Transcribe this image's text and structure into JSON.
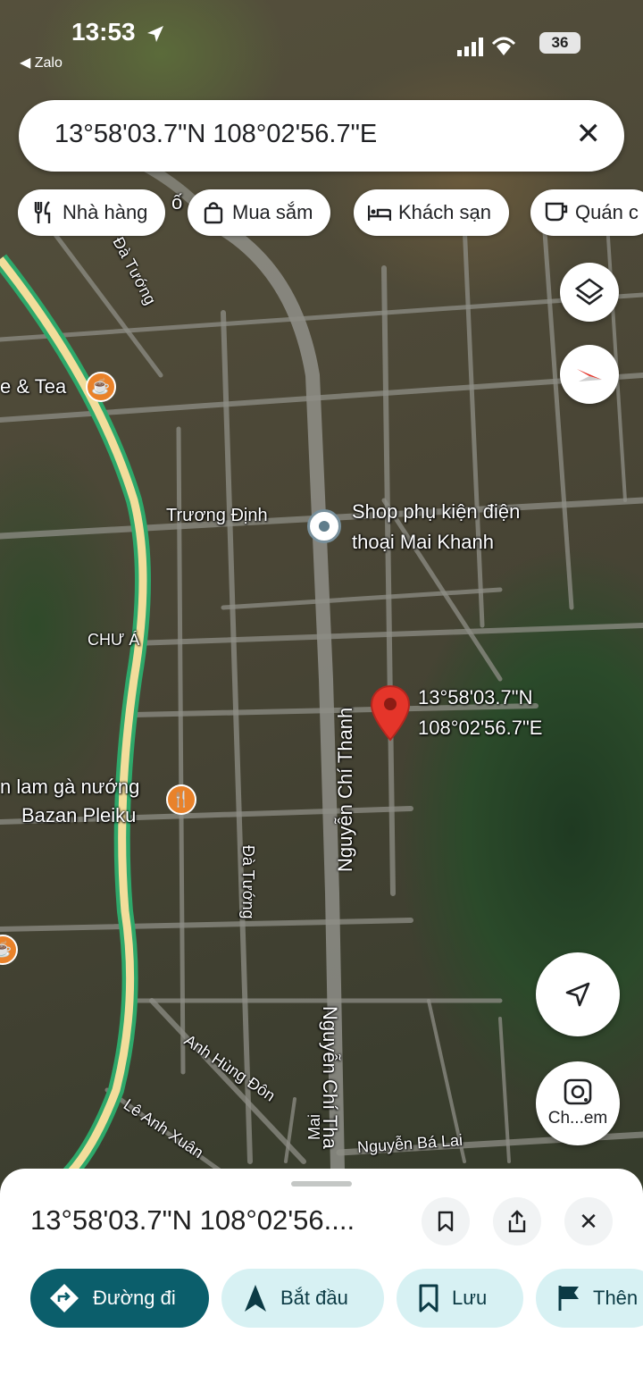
{
  "status_bar": {
    "time": "13:53",
    "back_app": "Zalo",
    "battery": "36"
  },
  "search": {
    "query": "13°58'03.7\"N 108°02'56.7\"E",
    "close_icon": "close-icon"
  },
  "chips": [
    {
      "label": "Nhà hàng",
      "icon": "fork-knife-icon"
    },
    {
      "label": "Mua sắm",
      "icon": "shopping-bag-icon"
    },
    {
      "label": "Khách sạn",
      "icon": "bed-icon"
    },
    {
      "label": "Quán c",
      "icon": "coffee-icon"
    }
  ],
  "map_labels": {
    "cafe_tea": "e & Tea",
    "truong_dinh": "Trương Định",
    "shop_line1": "Shop phụ kiện điện",
    "shop_line2": "thoại Mai Khanh",
    "chu_a": "CHƯ Á",
    "restaurant_line1": "n lam gà nướng",
    "restaurant_line2": "Bazan Pleiku",
    "da_tuong_top": "Đà Tướng",
    "da_tuong_mid": "Đà Tướng",
    "nguyen_chi_thanh_1": "Nguyễn Chí Thanh",
    "nguyen_chi_thanh_2": "Nguyễn Chí Tha",
    "anh_hung_don": "Anh Hùng Đôn",
    "le_anh_xuan": "Lê Anh Xuân",
    "nguyen_ba_lai": "Nguyễn Bá Lai",
    "mai": "Mai",
    "top_fragment": "ố",
    "pin_line1": "13°58'03.7\"N",
    "pin_line2": "108°02'56.7\"E"
  },
  "controls": {
    "layers_icon": "layers-icon",
    "compass_icon": "compass-icon",
    "location_icon": "my-location-icon",
    "lens_icon": "lens-icon",
    "lens_label": "Ch...em"
  },
  "sheet": {
    "title": "13°58'03.7\"N 108°02'56....",
    "save_icon": "bookmark-icon",
    "share_icon": "share-icon",
    "close_icon": "close-icon",
    "actions": [
      {
        "label": "Đường đi",
        "icon": "directions-icon"
      },
      {
        "label": "Bắt đầu",
        "icon": "navigation-arrow-icon"
      },
      {
        "label": "Lưu",
        "icon": "bookmark-icon"
      },
      {
        "label": "Thên",
        "icon": "flag-icon"
      }
    ]
  },
  "colors": {
    "highway": "#2ea86a",
    "highway_core": "#f2dd9b",
    "pin": "#e5352a",
    "primary_action": "#0b5e6b",
    "secondary_action": "#d7f1f3",
    "poi_orange": "#e9822a"
  }
}
